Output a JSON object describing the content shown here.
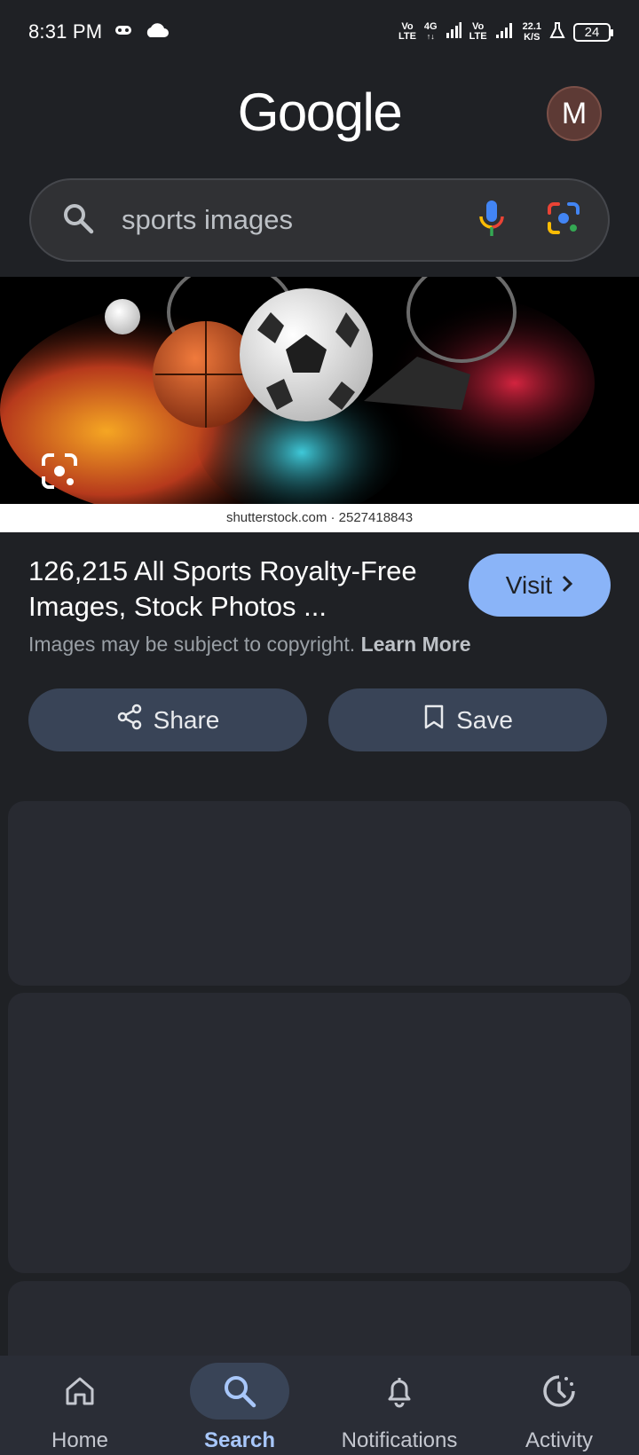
{
  "status_bar": {
    "time": "8:31 PM",
    "net1_top": "Vo",
    "net1_bottom": "LTE",
    "net2_top": "4G",
    "net3_top": "Vo",
    "net3_bottom": "LTE",
    "speed_value": "22.1",
    "speed_unit": "K/S",
    "battery": "24"
  },
  "header": {
    "logo_text": "Google",
    "avatar_letter": "M"
  },
  "search": {
    "query": "sports images"
  },
  "image_result": {
    "source_caption": "shutterstock.com · 2527418843",
    "title": "126,215 All Sports Royalty-Free Images, Stock Photos ...",
    "visit_label": "Visit",
    "copyright_text": "Images may be subject to copyright.",
    "learn_more": "Learn More",
    "share_label": "Share",
    "save_label": "Save"
  },
  "bottom_nav": {
    "items": [
      {
        "label": "Home",
        "icon": "home-icon"
      },
      {
        "label": "Search",
        "icon": "search-icon"
      },
      {
        "label": "Notifications",
        "icon": "bell-icon"
      },
      {
        "label": "Activity",
        "icon": "activity-icon"
      }
    ],
    "active_index": 1
  },
  "colors": {
    "background": "#1f2125",
    "accent": "#8ab4f8",
    "button_bg": "#394457",
    "card_bg": "#282a31"
  }
}
